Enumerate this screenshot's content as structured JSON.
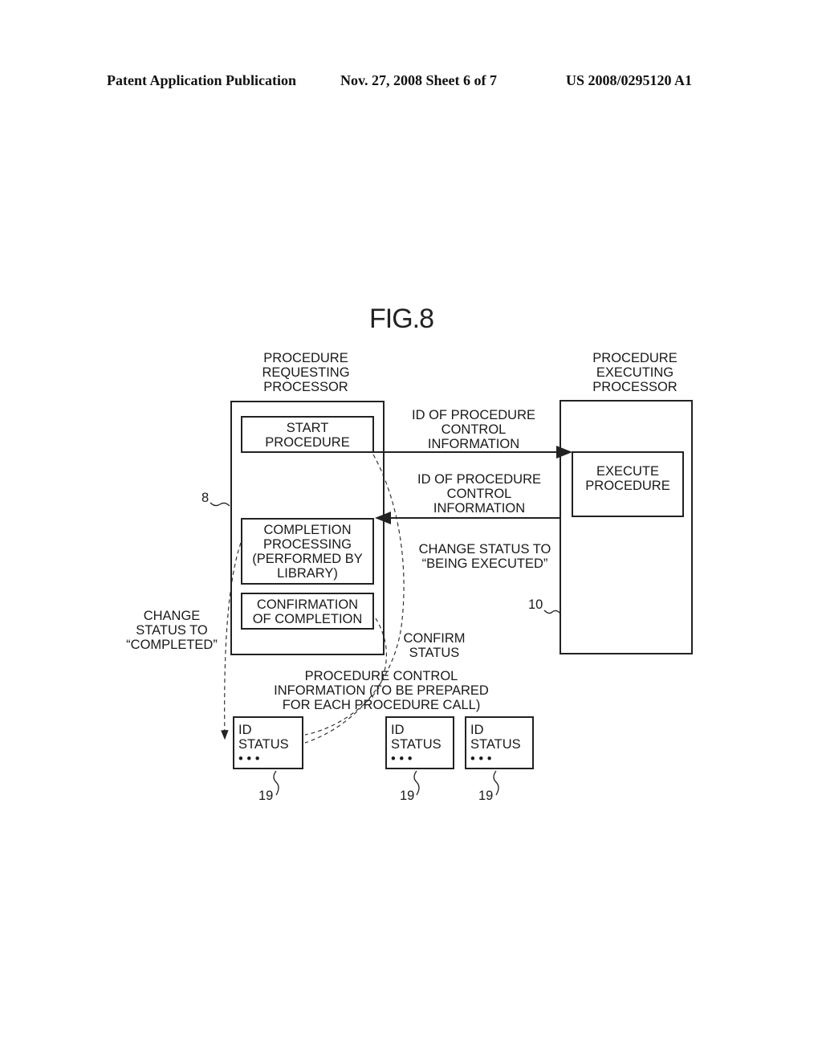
{
  "header": {
    "publication": "Patent Application Publication",
    "date_sheet": "Nov. 27, 2008   Sheet 6 of 7",
    "patent_number": "US 2008/0295120 A1"
  },
  "figure": {
    "title": "FIG.8",
    "requesting_processor": {
      "label": "PROCEDURE\nREQUESTING\nPROCESSOR",
      "ref": "8",
      "start_procedure": "START\nPROCEDURE",
      "completion_processing": "COMPLETION\nPROCESSING\n(PERFORMED BY\nLIBRARY)",
      "confirmation": "CONFIRMATION\nOF COMPLETION"
    },
    "executing_processor": {
      "label": "PROCEDURE\nEXECUTING\nPROCESSOR",
      "ref": "10",
      "execute_procedure": "EXECUTE\nPROCEDURE"
    },
    "arrows": {
      "request_label": "ID OF PROCEDURE\nCONTROL\nINFORMATION",
      "response_label": "ID OF PROCEDURE\nCONTROL\nINFORMATION",
      "being_executed_label": "CHANGE STATUS TO\n“BEING EXECUTED”",
      "completed_label": "CHANGE\nSTATUS TO\n“COMPLETED”",
      "confirm_label": "CONFIRM\nSTATUS"
    },
    "control_info": {
      "label": "PROCEDURE CONTROL\nINFORMATION (TO BE PREPARED\nFOR EACH PROCEDURE CALL)",
      "blocks": [
        {
          "text": "ID\nSTATUS\n• • •",
          "ref": "19"
        },
        {
          "text": "ID\nSTATUS\n• • •",
          "ref": "19"
        },
        {
          "text": "ID\nSTATUS\n• • •",
          "ref": "19"
        }
      ]
    }
  }
}
